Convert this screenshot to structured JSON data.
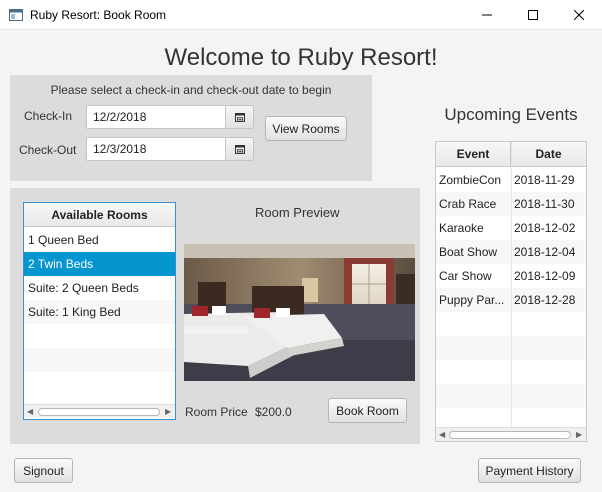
{
  "window": {
    "title": "Ruby Resort: Book Room",
    "controls": [
      "minimize-icon",
      "maximize-icon",
      "close-icon"
    ]
  },
  "header": {
    "welcome": "Welcome to Ruby Resort!"
  },
  "dates": {
    "prompt": "Please select a check-in and check-out date to begin",
    "checkin_label": "Check-In",
    "checkin_value": "12/2/2018",
    "checkout_label": "Check-Out",
    "checkout_value": "12/3/2018",
    "calendar_icon": "calendar-icon",
    "view_rooms_label": "View Rooms"
  },
  "rooms": {
    "header": "Available Rooms",
    "items": [
      {
        "label": "1 Queen Bed"
      },
      {
        "label": "2 Twin Beds"
      },
      {
        "label": "Suite: 2 Queen Beds"
      },
      {
        "label": "Suite: 1 King Bed"
      }
    ],
    "selected_index": 1
  },
  "preview": {
    "title": "Room Preview",
    "price_label": "Room Price",
    "price_value": "$200.0",
    "book_label": "Book Room"
  },
  "events": {
    "title": "Upcoming Events",
    "columns": [
      "Event",
      "Date"
    ],
    "rows": [
      {
        "event": "ZombieCon",
        "date": "2018-11-29"
      },
      {
        "event": "Crab Race",
        "date": "2018-11-30"
      },
      {
        "event": "Karaoke",
        "date": "2018-12-02"
      },
      {
        "event": "Boat Show",
        "date": "2018-12-04"
      },
      {
        "event": "Car Show",
        "date": "2018-12-09"
      },
      {
        "event": "Puppy Par...",
        "date": "2018-12-28"
      }
    ]
  },
  "footer": {
    "signout_label": "Signout",
    "payment_history_label": "Payment History"
  },
  "colors": {
    "selection": "#0596d0",
    "panel": "#dcdcdc",
    "list_focus_border": "#3a8fd1"
  }
}
